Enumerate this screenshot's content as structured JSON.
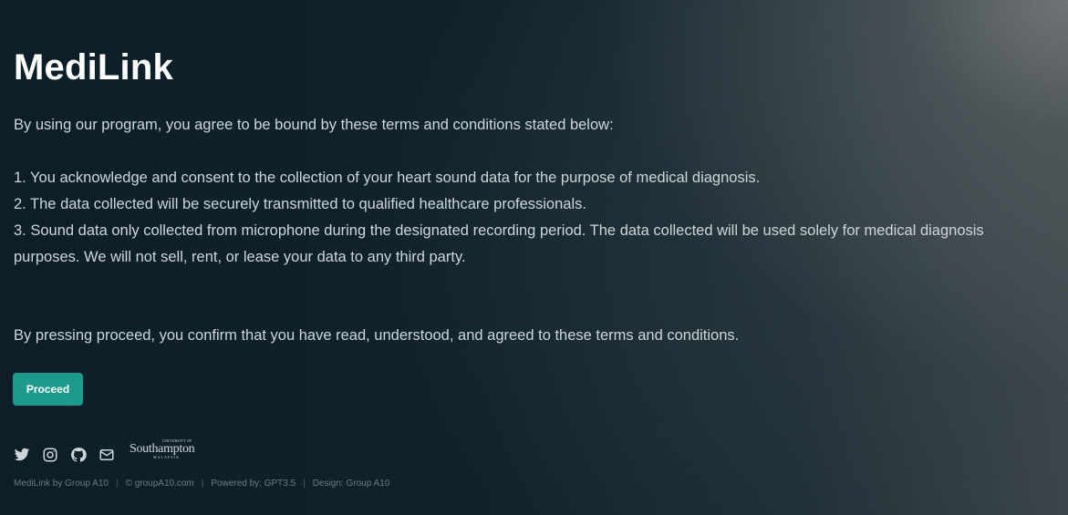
{
  "header": {
    "title": "MediLink"
  },
  "content": {
    "intro": "By using our program, you agree to be bound by these terms and conditions stated below:",
    "terms": [
      "1. You acknowledge and consent to the collection of your heart sound data for the purpose of medical diagnosis.",
      "2. The data collected will be securely transmitted to qualified healthcare professionals.",
      "3. Sound data only collected from microphone during the designated recording period. The data collected will be used solely for medical diagnosis purposes. We will not sell, rent, or lease your data to any third party."
    ],
    "confirm": "By pressing proceed, you confirm that you have read, understood, and agreed to these terms and conditions."
  },
  "actions": {
    "proceed_label": "Proceed"
  },
  "social": {
    "icons": [
      "twitter-icon",
      "instagram-icon",
      "github-icon",
      "mail-icon"
    ],
    "logo": {
      "top": "UNIVERSITY OF",
      "main": "Southampton",
      "bottom": "MALAYSIA"
    }
  },
  "footer": {
    "items": [
      "MediLink by Group A10",
      "© groupA10.com",
      "Powered by: GPT3.5",
      "Design: Group A10"
    ]
  },
  "colors": {
    "accent": "#1d9a8c",
    "background": "#0c1e28",
    "title": "#ffffff"
  }
}
